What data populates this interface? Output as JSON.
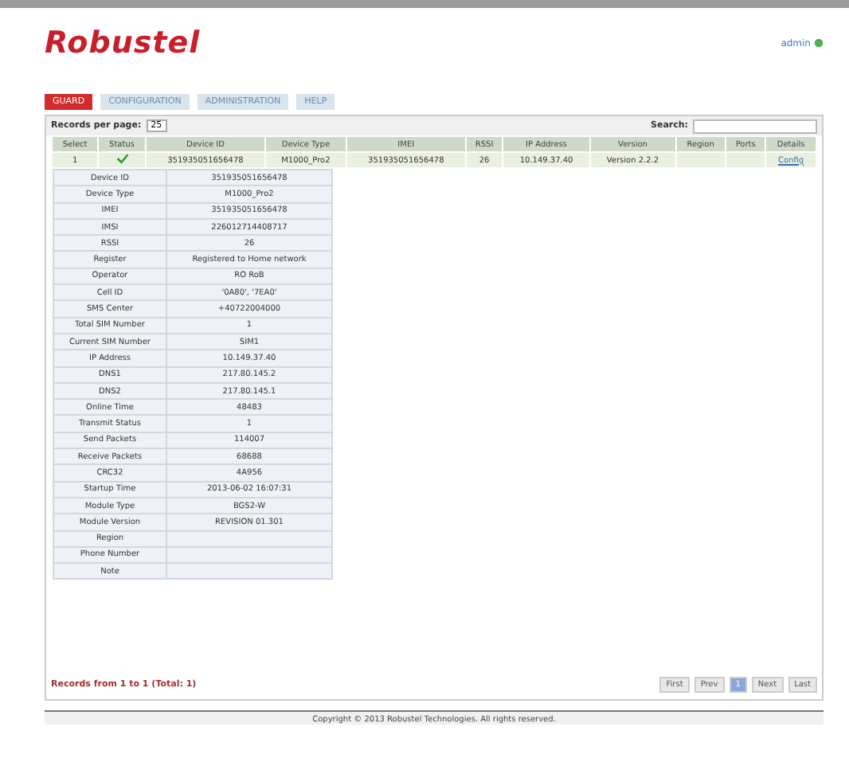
{
  "logo": "Robustel",
  "user": {
    "name": "admin"
  },
  "tabs": [
    {
      "label": "GUARD",
      "selected": true
    },
    {
      "label": "CONFIGURATION",
      "selected": false
    },
    {
      "label": "ADMINISTRATION",
      "selected": false
    },
    {
      "label": "HELP",
      "selected": false
    }
  ],
  "records_per_page": {
    "label": "Records per page:",
    "value": "25"
  },
  "search": {
    "label": "Search:"
  },
  "table": {
    "columns": [
      "Select",
      "Status",
      "Device ID",
      "Device Type",
      "IMEI",
      "RSSI",
      "IP Address",
      "Version",
      "Region",
      "Ports",
      "Details"
    ],
    "rows": [
      {
        "select": "1",
        "online": true,
        "device_id": "351935051656478",
        "device_type": "M1000_Pro2",
        "imei": "351935051656478",
        "rssi": "26",
        "ip": "10.149.37.40",
        "version": "Version 2.2.2",
        "details": "Config"
      }
    ]
  },
  "details": [
    {
      "label": "Device ID",
      "value": "351935051656478"
    },
    {
      "label": "Device Type",
      "value": "M1000_Pro2"
    },
    {
      "label": "IMEI",
      "value": "351935051656478"
    },
    {
      "label": "IMSI",
      "value": "226012714408717"
    },
    {
      "label": "RSSI",
      "value": "26"
    },
    {
      "label": "Register",
      "value": "Registered to Home network"
    },
    {
      "label": "Operator",
      "value": "RO RoB"
    },
    {
      "label": "Cell ID",
      "value": "'0A80', '7EA0'"
    },
    {
      "label": "SMS Center",
      "value": "+40722004000"
    },
    {
      "label": "Total SIM Number",
      "value": "1"
    },
    {
      "label": "Current SIM Number",
      "value": "SIM1"
    },
    {
      "label": "IP Address",
      "value": "10.149.37.40"
    },
    {
      "label": "DNS1",
      "value": "217.80.145.2"
    },
    {
      "label": "DNS2",
      "value": "217.80.145.1"
    },
    {
      "label": "Online Time",
      "value": "48483"
    },
    {
      "label": "Transmit Status",
      "value": "1"
    },
    {
      "label": "Send Packets",
      "value": "114007"
    },
    {
      "label": "Receive Packets",
      "value": "68688"
    },
    {
      "label": "CRC32",
      "value": "4A956"
    },
    {
      "label": "Startup Time",
      "value": "2013-06-02 16:07:31"
    },
    {
      "label": "Module Type",
      "value": "BGS2-W"
    },
    {
      "label": "Module Version",
      "value": "REVISION 01.301"
    },
    {
      "label": "Region"
    },
    {
      "label": "Phone Number"
    },
    {
      "label": "Note"
    }
  ],
  "records_info": "Records from 1 to 1 (Total: 1)",
  "pagination": [
    {
      "label": "First",
      "selected": false
    },
    {
      "label": "Prev",
      "selected": false
    },
    {
      "label": "1",
      "selected": true
    },
    {
      "label": "Next",
      "selected": false
    },
    {
      "label": "Last",
      "selected": false
    }
  ],
  "copyright": "Copyright © 2013 Robustel Technologies. All rights reserved."
}
